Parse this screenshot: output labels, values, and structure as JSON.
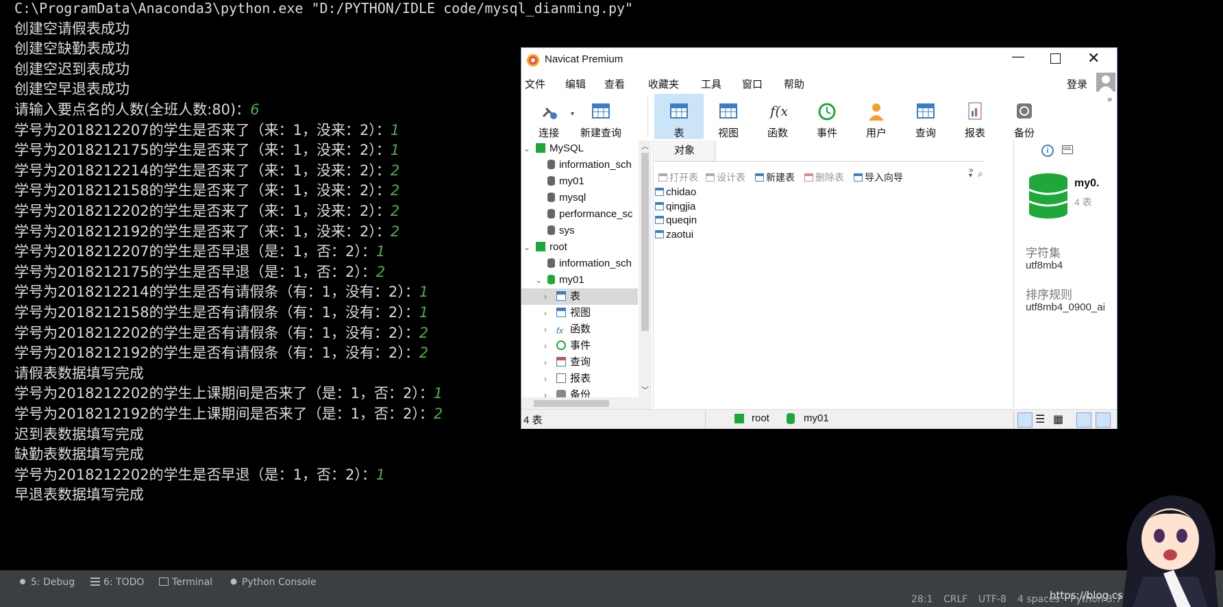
{
  "console": {
    "lines": [
      {
        "text": "C:\\ProgramData\\Anaconda3\\python.exe \"D:/PYTHON/IDLE code/mysql_dianming.py\"",
        "input": ""
      },
      {
        "text": "创建空请假表成功",
        "input": ""
      },
      {
        "text": "创建空缺勤表成功",
        "input": ""
      },
      {
        "text": "创建空迟到表成功",
        "input": ""
      },
      {
        "text": "创建空早退表成功",
        "input": ""
      },
      {
        "text": "请输入要点名的人数(全班人数:80)：",
        "input": "6"
      },
      {
        "text": "学号为2018212207的学生是否来了（来：1，没来：2）：",
        "input": "1"
      },
      {
        "text": "学号为2018212175的学生是否来了（来：1，没来：2）：",
        "input": "1"
      },
      {
        "text": "学号为2018212214的学生是否来了（来：1，没来：2）：",
        "input": "2"
      },
      {
        "text": "学号为2018212158的学生是否来了（来：1，没来：2）：",
        "input": "2"
      },
      {
        "text": "学号为2018212202的学生是否来了（来：1，没来：2）：",
        "input": "2"
      },
      {
        "text": "学号为2018212192的学生是否来了（来：1，没来：2）：",
        "input": "2"
      },
      {
        "text": "学号为2018212207的学生是否早退（是：1，否：2）：",
        "input": "1"
      },
      {
        "text": "学号为2018212175的学生是否早退（是：1，否：2）：",
        "input": "2"
      },
      {
        "text": "学号为2018212214的学生是否有请假条（有：1，没有：2）：",
        "input": "1"
      },
      {
        "text": "学号为2018212158的学生是否有请假条（有：1，没有：2）：",
        "input": "1"
      },
      {
        "text": "学号为2018212202的学生是否有请假条（有：1，没有：2）：",
        "input": "2"
      },
      {
        "text": "学号为2018212192的学生是否有请假条（有：1，没有：2）：",
        "input": "2"
      },
      {
        "text": "请假表数据填写完成",
        "input": ""
      },
      {
        "text": "学号为2018212202的学生上课期间是否来了（是：1，否：2）：",
        "input": "1"
      },
      {
        "text": "学号为2018212192的学生上课期间是否来了（是：1，否：2）：",
        "input": "2"
      },
      {
        "text": "迟到表数据填写完成",
        "input": ""
      },
      {
        "text": "缺勤表数据填写完成",
        "input": ""
      },
      {
        "text": "学号为2018212202的学生是否早退（是：1，否：2）：",
        "input": "1"
      },
      {
        "text": "早退表数据填写完成",
        "input": ""
      }
    ]
  },
  "tool_windows": {
    "debug": "5: Debug",
    "todo": "6: TODO",
    "terminal": "Terminal",
    "python_console": "Python Console"
  },
  "status_bar": {
    "position": "28:1",
    "line_sep": "CRLF",
    "encoding": "UTF-8",
    "indent": "4 spaces",
    "interpreter": "Python 3.7",
    "watermark": "https://blog.csdn.net/qq_4..5176",
    "lo": "Lo"
  },
  "navicat": {
    "title": "Navicat Premium",
    "menu": [
      "文件",
      "编辑",
      "查看",
      "收藏夹",
      "工具",
      "窗口",
      "帮助"
    ],
    "login": "登录",
    "toolbar": [
      {
        "label": "连接",
        "icon": "plug-icon"
      },
      {
        "label": "新建查询",
        "icon": "new-query-icon"
      },
      {
        "label": "表",
        "icon": "table-icon"
      },
      {
        "label": "视图",
        "icon": "view-icon"
      },
      {
        "label": "函数",
        "icon": "function-icon"
      },
      {
        "label": "事件",
        "icon": "event-clock-icon"
      },
      {
        "label": "用户",
        "icon": "user-icon"
      },
      {
        "label": "查询",
        "icon": "query-icon"
      },
      {
        "label": "报表",
        "icon": "report-icon"
      },
      {
        "label": "备份",
        "icon": "backup-icon"
      }
    ],
    "tree": [
      {
        "label": "MySQL",
        "level": 0,
        "kind": "conn"
      },
      {
        "label": "information_sch",
        "level": 1,
        "kind": "db"
      },
      {
        "label": "my01",
        "level": 1,
        "kind": "db"
      },
      {
        "label": "mysql",
        "level": 1,
        "kind": "db"
      },
      {
        "label": "performance_sc",
        "level": 1,
        "kind": "db"
      },
      {
        "label": "sys",
        "level": 1,
        "kind": "db"
      },
      {
        "label": "root",
        "level": 0,
        "kind": "conn"
      },
      {
        "label": "information_sch",
        "level": 1,
        "kind": "db"
      },
      {
        "label": "my01",
        "level": 1,
        "kind": "db-open"
      },
      {
        "label": "表",
        "level": 2,
        "kind": "table"
      },
      {
        "label": "视图",
        "level": 2,
        "kind": "view"
      },
      {
        "label": "函数",
        "level": 2,
        "kind": "func"
      },
      {
        "label": "事件",
        "level": 2,
        "kind": "event"
      },
      {
        "label": "查询",
        "level": 2,
        "kind": "query"
      },
      {
        "label": "报表",
        "level": 2,
        "kind": "report"
      },
      {
        "label": "备份",
        "level": 2,
        "kind": "backup"
      }
    ],
    "objects_tab": "对象",
    "object_toolbar": {
      "open": "打开表",
      "design": "设计表",
      "new": "新建表",
      "delete": "删除表",
      "import": "导入向导"
    },
    "tables": [
      "chidao",
      "qingjia",
      "queqin",
      "zaotui"
    ],
    "info": {
      "db_name": "my0.",
      "table_count": "4 表",
      "charset_label": "字符集",
      "charset": "utf8mb4",
      "collation_label": "排序规则",
      "collation": "utf8mb4_0900_ai"
    },
    "statusbar": {
      "count": "4 表",
      "conn": "root",
      "db": "my01"
    },
    "colors": {
      "accent": "#3b7ec4",
      "db_green": "#1fa83a",
      "selected": "#cce4f7"
    }
  }
}
